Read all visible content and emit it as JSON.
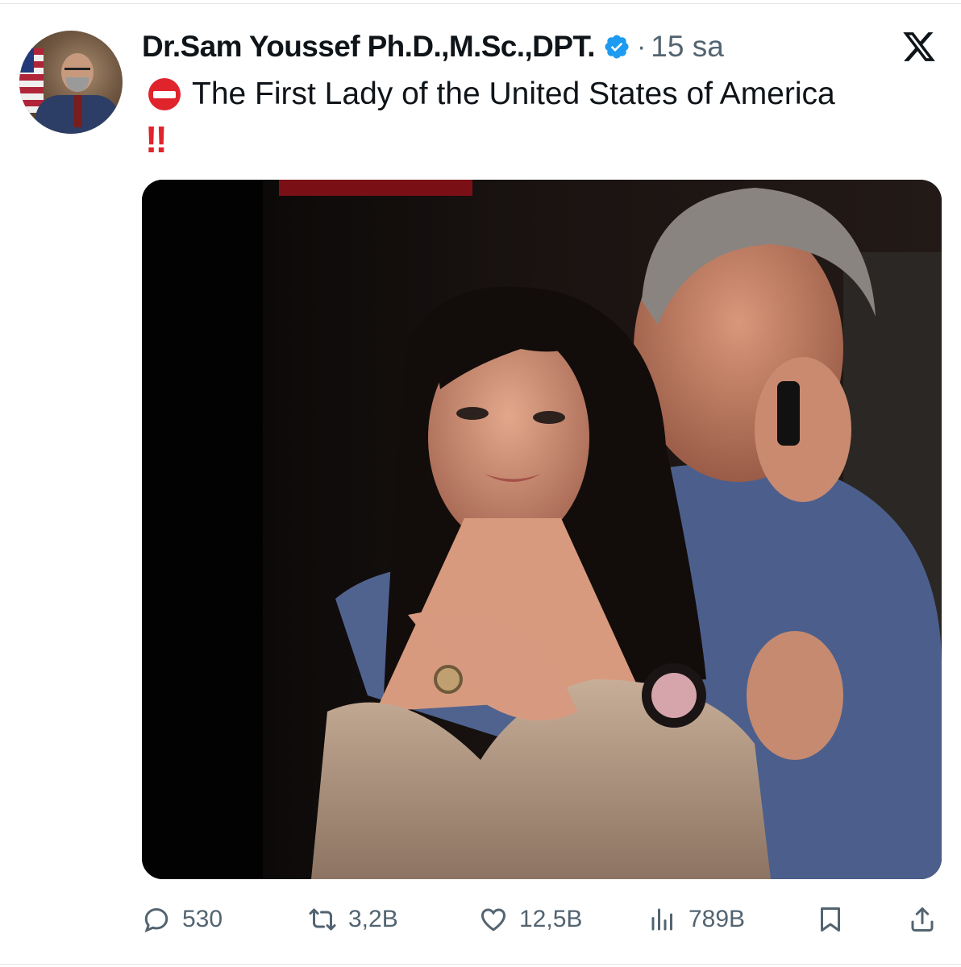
{
  "post": {
    "author": {
      "display_name": "Dr.Sam Youssef Ph.D.,M.Sc.,DPT.",
      "verified_icon": "verified-badge-icon",
      "avatar_icon": "avatar-portrait"
    },
    "separator": "·",
    "time_ago": "15 sa",
    "platform_logo": "x-logo-icon",
    "text": "The First Lady of the United States of America",
    "text_prefix_emoji": "no-entry-emoji",
    "text_suffix": "‼",
    "media": {
      "type": "photo",
      "alt_icon": "photo-image"
    },
    "stats": {
      "replies": "530",
      "reposts": "3,2B",
      "likes": "12,5B",
      "views": "789B"
    },
    "actions": {
      "reply_icon": "reply-icon",
      "repost_icon": "repost-icon",
      "like_icon": "heart-icon",
      "views_icon": "views-chart-icon",
      "bookmark_icon": "bookmark-icon",
      "share_icon": "share-icon"
    }
  },
  "colors": {
    "text_primary": "#0f1419",
    "text_secondary": "#536471",
    "verified_blue": "#1d9bf0",
    "emoji_red": "#e0242c",
    "background": "#ffffff"
  }
}
